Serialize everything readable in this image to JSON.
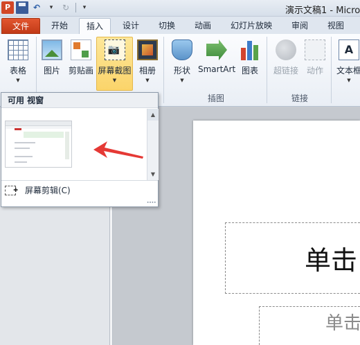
{
  "window": {
    "title": "演示文稿1 - Micro",
    "app_icon": "powerpoint-icon",
    "qat": {
      "save": "save-icon",
      "undo": "undo-icon",
      "redo": "redo-icon",
      "more": "qat-more-icon"
    }
  },
  "tabs": [
    {
      "label": "文件"
    },
    {
      "label": "开始"
    },
    {
      "label": "插入",
      "active": true
    },
    {
      "label": "设计"
    },
    {
      "label": "切换"
    },
    {
      "label": "动画"
    },
    {
      "label": "幻灯片放映"
    },
    {
      "label": "审阅"
    },
    {
      "label": "视图"
    }
  ],
  "ribbon": {
    "buttons": {
      "table": {
        "label": "表格",
        "icon": "table-icon"
      },
      "picture": {
        "label": "图片",
        "icon": "picture-icon"
      },
      "clipart": {
        "label": "剪贴画",
        "icon": "clipart-icon"
      },
      "screenshot": {
        "label": "屏幕截图",
        "icon": "screenshot-icon"
      },
      "album": {
        "label": "相册",
        "icon": "photo-album-icon"
      },
      "shapes": {
        "label": "形状",
        "icon": "shapes-icon"
      },
      "smartart": {
        "label": "SmartArt",
        "icon": "smartart-icon"
      },
      "chart": {
        "label": "图表",
        "icon": "chart-icon"
      },
      "hyperlink": {
        "label": "超链接",
        "icon": "hyperlink-icon",
        "disabled": true
      },
      "action": {
        "label": "动作",
        "icon": "action-icon",
        "disabled": true
      },
      "textbox": {
        "label": "文本框",
        "icon": "textbox-icon"
      }
    },
    "groups": {
      "illustrations": "插图",
      "links": "链接"
    }
  },
  "dropdown": {
    "header": "可用 视窗",
    "screen_clipping": "屏幕剪辑(C)"
  },
  "slide": {
    "title_placeholder": "单击",
    "subtitle_placeholder": "单击"
  },
  "colors": {
    "file_tab": "#d24726",
    "highlight": "#fbd46a",
    "annotation_arrow": "#e53935"
  }
}
